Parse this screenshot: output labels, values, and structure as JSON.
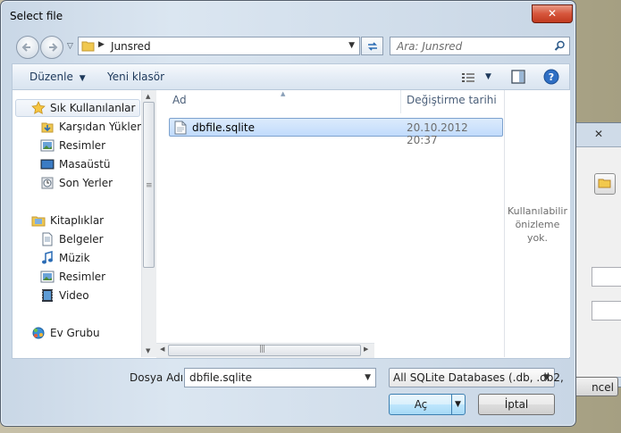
{
  "background_window": {
    "close_glyph": "✕",
    "button_text": "ncel"
  },
  "window": {
    "title": "Select file",
    "close_glyph": "✕"
  },
  "address": {
    "path": "Junsred"
  },
  "search": {
    "placeholder": "Ara: Junsred"
  },
  "toolbar": {
    "organize": "Düzenle",
    "new_folder": "Yeni klasör"
  },
  "sidebar": {
    "favorites": "Sık Kullanılanlar",
    "items": [
      {
        "label": "Karşıdan Yüklem",
        "icon": "downloads-icon"
      },
      {
        "label": "Resimler",
        "icon": "pictures-icon"
      },
      {
        "label": "Masaüstü",
        "icon": "desktop-icon"
      },
      {
        "label": "Son Yerler",
        "icon": "recent-places-icon"
      }
    ],
    "libraries": "Kitaplıklar",
    "library_items": [
      {
        "label": "Belgeler",
        "icon": "documents-icon"
      },
      {
        "label": "Müzik",
        "icon": "music-icon"
      },
      {
        "label": "Resimler",
        "icon": "pictures-icon"
      },
      {
        "label": "Video",
        "icon": "video-icon"
      }
    ],
    "homegroup": "Ev Grubu"
  },
  "columns": {
    "name": "Ad",
    "modified": "Değiştirme tarihi"
  },
  "files": [
    {
      "name": "dbfile.sqlite",
      "modified": "20.10.2012 20:37"
    }
  ],
  "preview": {
    "line1": "Kullanılabilir",
    "line2": "önizleme",
    "line3": "yok."
  },
  "footer": {
    "filename_label": "Dosya Adı:",
    "filename_value": "dbfile.sqlite",
    "filter_value": "All SQLite Databases (.db, .db2,",
    "open_label": "Aç",
    "cancel_label": "İptal"
  },
  "colors": {
    "selection": "#c1dbfc",
    "close_button": "#c13a1f"
  }
}
